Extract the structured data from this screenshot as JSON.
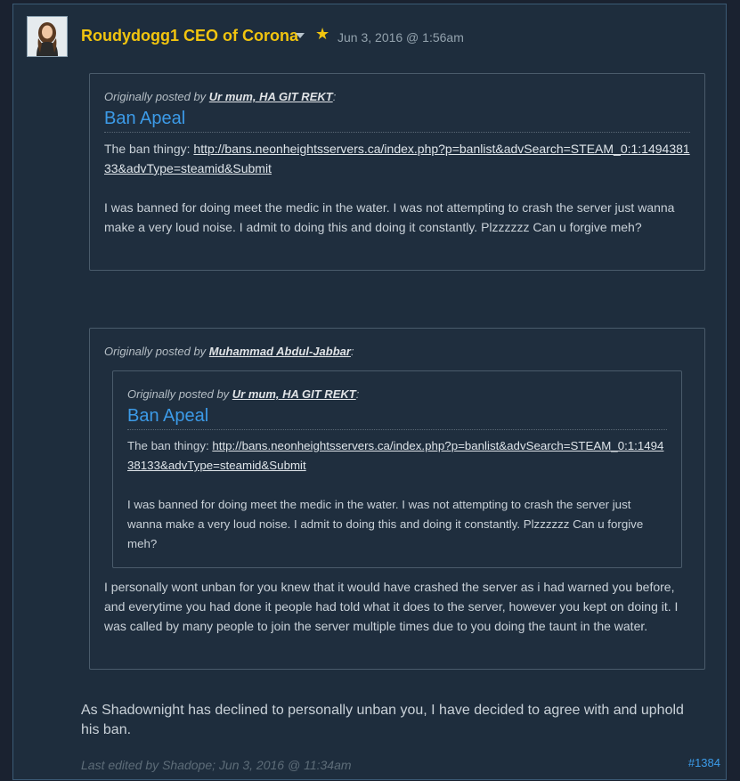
{
  "post": {
    "username": "Roudydogg1 CEO of Corona",
    "date": "Jun 3, 2016 @ 1:56am",
    "permalink": "#1384",
    "body": "As Shadownight has declined to personally unban you, I have decided to agree with and uphold his ban.",
    "edited_prefix": "Last edited by ",
    "edited_by": "Shadope",
    "edited_suffix": "; Jun 3, 2016 @ 11:34am"
  },
  "quote1": {
    "prefix": "Originally posted by ",
    "author": "Ur mum, HA GIT REKT",
    "suffix": ":",
    "title": "Ban Apeal",
    "line_label": "The ban thingy: ",
    "link": "http://bans.neonheightsservers.ca/index.php?p=banlist&advSearch=STEAM_0:1:149438133&advType=steamid&Submit",
    "text": "I was banned for doing meet the medic in the water. I was not attempting to crash the server just wanna make a very loud noise. I admit to doing this and doing it constantly. Plzzzzzz Can u forgive meh?"
  },
  "quote2": {
    "prefix": "Originally posted by ",
    "author": "Muhammad Abdul-Jabbar",
    "suffix": ":",
    "text": "I personally wont unban for you knew that it would have crashed the server as i had warned you before, and everytime you had done it people had told what it does to the server, however you kept on doing it. I was called by many people to join the server multiple times due to you doing the taunt in the water."
  },
  "quote2_inner": {
    "prefix": "Originally posted by ",
    "author": "Ur mum, HA GIT REKT",
    "suffix": ":",
    "title": "Ban Apeal",
    "line_label": "The ban thingy: ",
    "link": "http://bans.neonheightsservers.ca/index.php?p=banlist&advSearch=STEAM_0:1:149438133&advType=steamid&Submit",
    "text": "I was banned for doing meet the medic in the water. I was not attempting to crash the server just wanna make a very loud noise. I admit to doing this and doing it constantly. Plzzzzzz Can u forgive meh?"
  },
  "colors": {
    "background": "#1e2d3d",
    "username": "#f1c40f",
    "link_title": "#3c9be8",
    "text": "#c9d1d8"
  },
  "icons": {
    "avatar": "user-avatar",
    "caret": "chevron-down-icon",
    "star": "star-icon"
  }
}
